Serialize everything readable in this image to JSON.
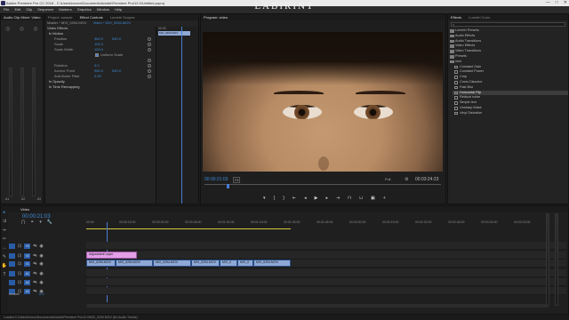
{
  "window": {
    "title": "Adobe Premiere Pro CC 2018 - C:\\Users\\ixxxxx\\Documents\\Adobe\\Premiere Pro\\12.0\\Untitled.prproj",
    "controls": [
      "—",
      "□",
      "✕"
    ]
  },
  "watermark": "LABIRINT",
  "menu": [
    "File",
    "Edit",
    "Clip",
    "Sequence",
    "Markers",
    "Graphics",
    "Window",
    "Help"
  ],
  "left_panel": {
    "tab": "Audio Clip Mixer: Video",
    "meter_ticks": [
      "-6",
      "-12",
      "-18",
      "-24",
      "-30",
      "-36",
      "-42",
      "-48",
      "-54"
    ],
    "channels": [
      "A1",
      "A2",
      "A3"
    ]
  },
  "effect_controls": {
    "tabs": [
      "Project: sample",
      "Effect Controls",
      "Lumetri Scopes"
    ],
    "active_tab": "Effect Controls",
    "header_master": "Master * MVI_0294.MOV",
    "header_clip": "Video * MVI_0294.MOV",
    "mini_timecode": "00:00",
    "mini_clip": "MVI_0294.MOV",
    "section_video": "Video Effects",
    "motion": "fx  Motion",
    "rows": [
      {
        "label": "Position",
        "v1": "960.0",
        "v2": "540.0"
      },
      {
        "label": "Scale",
        "v1": "100.0",
        "v2": ""
      },
      {
        "label": "Scale Width",
        "v1": "100.0",
        "v2": ""
      },
      {
        "label": "",
        "v1": "",
        "v2": ""
      },
      {
        "label": "Rotation",
        "v1": "0.0",
        "v2": ""
      },
      {
        "label": "Anchor Point",
        "v1": "960.0",
        "v2": "540.0"
      },
      {
        "label": "Anti-flicker Filter",
        "v1": "0.00",
        "v2": ""
      }
    ],
    "uniform_scale": "Uniform Scale",
    "opacity": "fx  Opacity",
    "time_remap": "fx  Time Remapping"
  },
  "program": {
    "tab": "Program: video",
    "timecode": "00:00:21:03",
    "fit": "Fit",
    "full": "Full",
    "duration": "00:03:24:23"
  },
  "effects_panel": {
    "tabs": [
      "Effects",
      "Lumetri Color"
    ],
    "folders": [
      "Lumetri Presets",
      "Audio Effects",
      "Audio Transitions",
      "Video Effects",
      "Video Transitions",
      "Presets"
    ],
    "open_folder": "new",
    "items": [
      "Constant Gain",
      "Constant Power",
      "Crop",
      "Cross Dissolve",
      "Fast Blur",
      "Horizontal Flip",
      "Reduce noise",
      "Simple text",
      "Unsharp Mask",
      "Vinyl Distortion"
    ],
    "selected_item": "Horizontal Flip"
  },
  "timeline": {
    "sequence_tab": "Video",
    "timecode": "00:00:21:03",
    "ruler": [
      "00:00",
      "00:00:15:00",
      "00:00:30:00",
      "00:00:45:00",
      "00:01:00:00",
      "00:01:15:00",
      "00:01:30:00",
      "00:01:45:00",
      "00:02:00:00",
      "00:02:15:00",
      "00:02:30:00",
      "00:02:45:00",
      "00:03:00:00",
      "00:03:15:00"
    ],
    "tracks": [
      {
        "name": "V3",
        "lane": "v3",
        "clips": []
      },
      {
        "name": "V2",
        "lane": "v2",
        "clips": [
          {
            "label": "Adjustment Layer",
            "type": "pink"
          }
        ]
      },
      {
        "name": "V1",
        "lane": "v1",
        "clips": [
          {
            "label": "MVI_0294.MOV",
            "type": "vclip"
          },
          {
            "label": "MVI_0294.MOV",
            "type": "vclip"
          },
          {
            "label": "MVI_0294.MOV",
            "type": "vclip"
          },
          {
            "label": "MVI_0294.MOV",
            "type": "vclip"
          },
          {
            "label": "MVI_0",
            "type": "vclip"
          },
          {
            "label": "MVI_0",
            "type": "vclip"
          },
          {
            "label": "MVI_0294.MOV",
            "type": "vclip"
          }
        ]
      },
      {
        "name": "A1",
        "lane": "a1",
        "clips": []
      },
      {
        "name": "A2",
        "lane": "a2",
        "clips": []
      },
      {
        "name": "A3",
        "lane": "a3",
        "clips": []
      }
    ],
    "master": "Master",
    "master_value": "0.0"
  },
  "statusbar": "Loaded C:\\Users\\ixxxxx\\Documents\\Adobe\\Premiere Pro\\12.0\\MVI_0294.MOV (No Audio Tracks)"
}
